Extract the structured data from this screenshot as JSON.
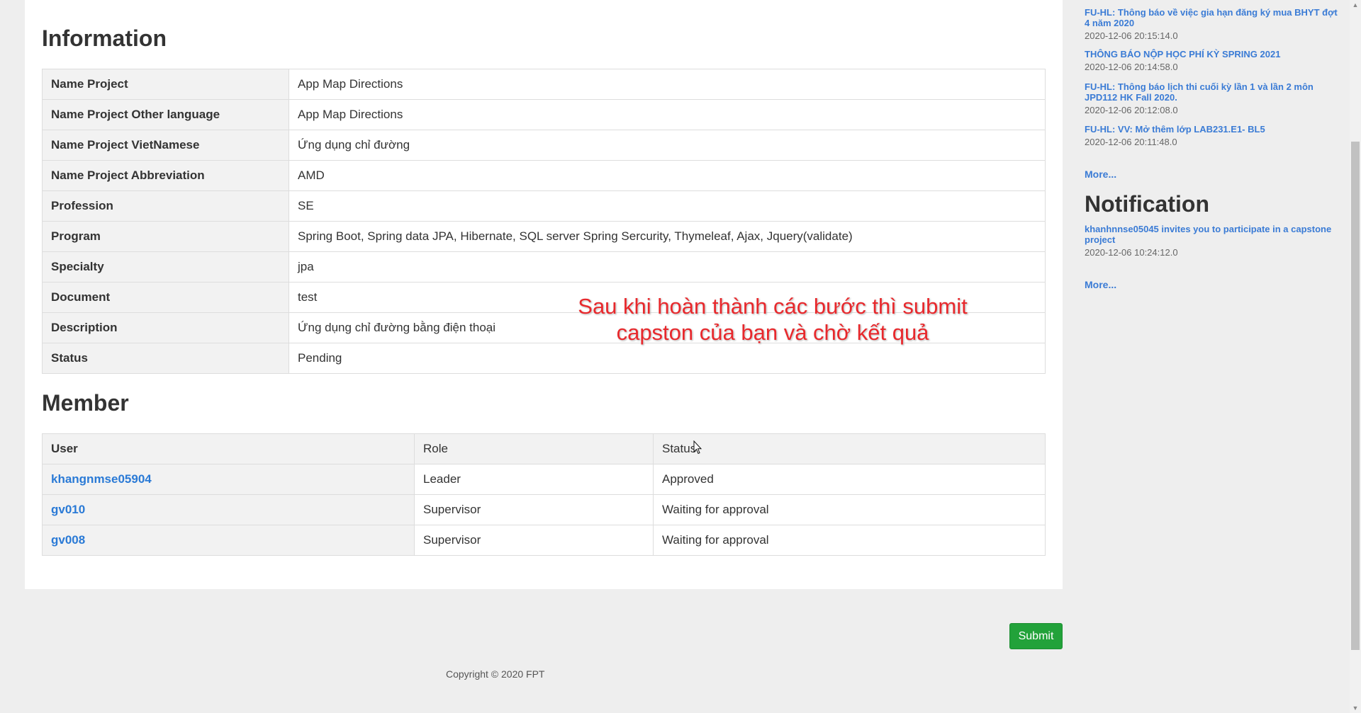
{
  "information": {
    "title": "Information",
    "rows": [
      {
        "label": "Name Project",
        "value": "App Map Directions"
      },
      {
        "label": "Name Project Other language",
        "value": "App Map Directions"
      },
      {
        "label": "Name Project VietNamese",
        "value": "Ứng dụng chỉ đường"
      },
      {
        "label": "Name Project Abbreviation",
        "value": "AMD"
      },
      {
        "label": "Profession",
        "value": "SE"
      },
      {
        "label": "Program",
        "value": "Spring Boot, Spring data JPA, Hibernate, SQL server Spring Sercurity, Thymeleaf, Ajax, Jquery(validate)"
      },
      {
        "label": "Specialty",
        "value": "jpa"
      },
      {
        "label": "Document",
        "value": "test"
      },
      {
        "label": "Description",
        "value": "Ứng dụng chỉ đường bằng điện thoại"
      },
      {
        "label": "Status",
        "value": "Pending"
      }
    ]
  },
  "member": {
    "title": "Member",
    "headers": [
      "User",
      "Role",
      "Status"
    ],
    "rows": [
      {
        "user": "khangnmse05904",
        "role": "Leader",
        "status": "Approved"
      },
      {
        "user": "gv010",
        "role": "Supervisor",
        "status": "Waiting for approval"
      },
      {
        "user": "gv008",
        "role": "Supervisor",
        "status": "Waiting for approval"
      }
    ]
  },
  "overlay_caption": {
    "line1": "Sau khi hoàn thành các bước thì submit",
    "line2": "capston của bạn và chờ kết quả"
  },
  "submit_label": "Submit",
  "footer": {
    "copyright": "Copyright © 2020 FPT"
  },
  "sidebar": {
    "news": [
      {
        "title": "FU-HL: Thông báo về việc gia hạn đăng ký mua BHYT đợt 4 năm 2020",
        "date": "2020-12-06 20:15:14.0"
      },
      {
        "title": "THÔNG BÁO NỘP HỌC PHÍ KỲ SPRING 2021",
        "date": "2020-12-06 20:14:58.0"
      },
      {
        "title": "FU-HL: Thông báo lịch thi cuối kỳ lần 1 và lần 2 môn JPD112 HK Fall 2020.",
        "date": "2020-12-06 20:12:08.0"
      },
      {
        "title": "FU-HL: VV: Mở thêm lớp LAB231.E1- BL5",
        "date": "2020-12-06 20:11:48.0"
      }
    ],
    "news_more": "More...",
    "notification_title": "Notification",
    "notifications": [
      {
        "title": "khanhnnse05045 invites you to participate in a capstone project",
        "date": "2020-12-06 10:24:12.0"
      }
    ],
    "notification_more": "More..."
  },
  "icons": {
    "cursor": "mouse-pointer-icon",
    "scroll_up": "chevron-up-icon",
    "scroll_down": "chevron-down-icon"
  },
  "colors": {
    "link": "#2a7ad6",
    "submit": "#22a23a",
    "overlay_text": "#e8282c"
  }
}
